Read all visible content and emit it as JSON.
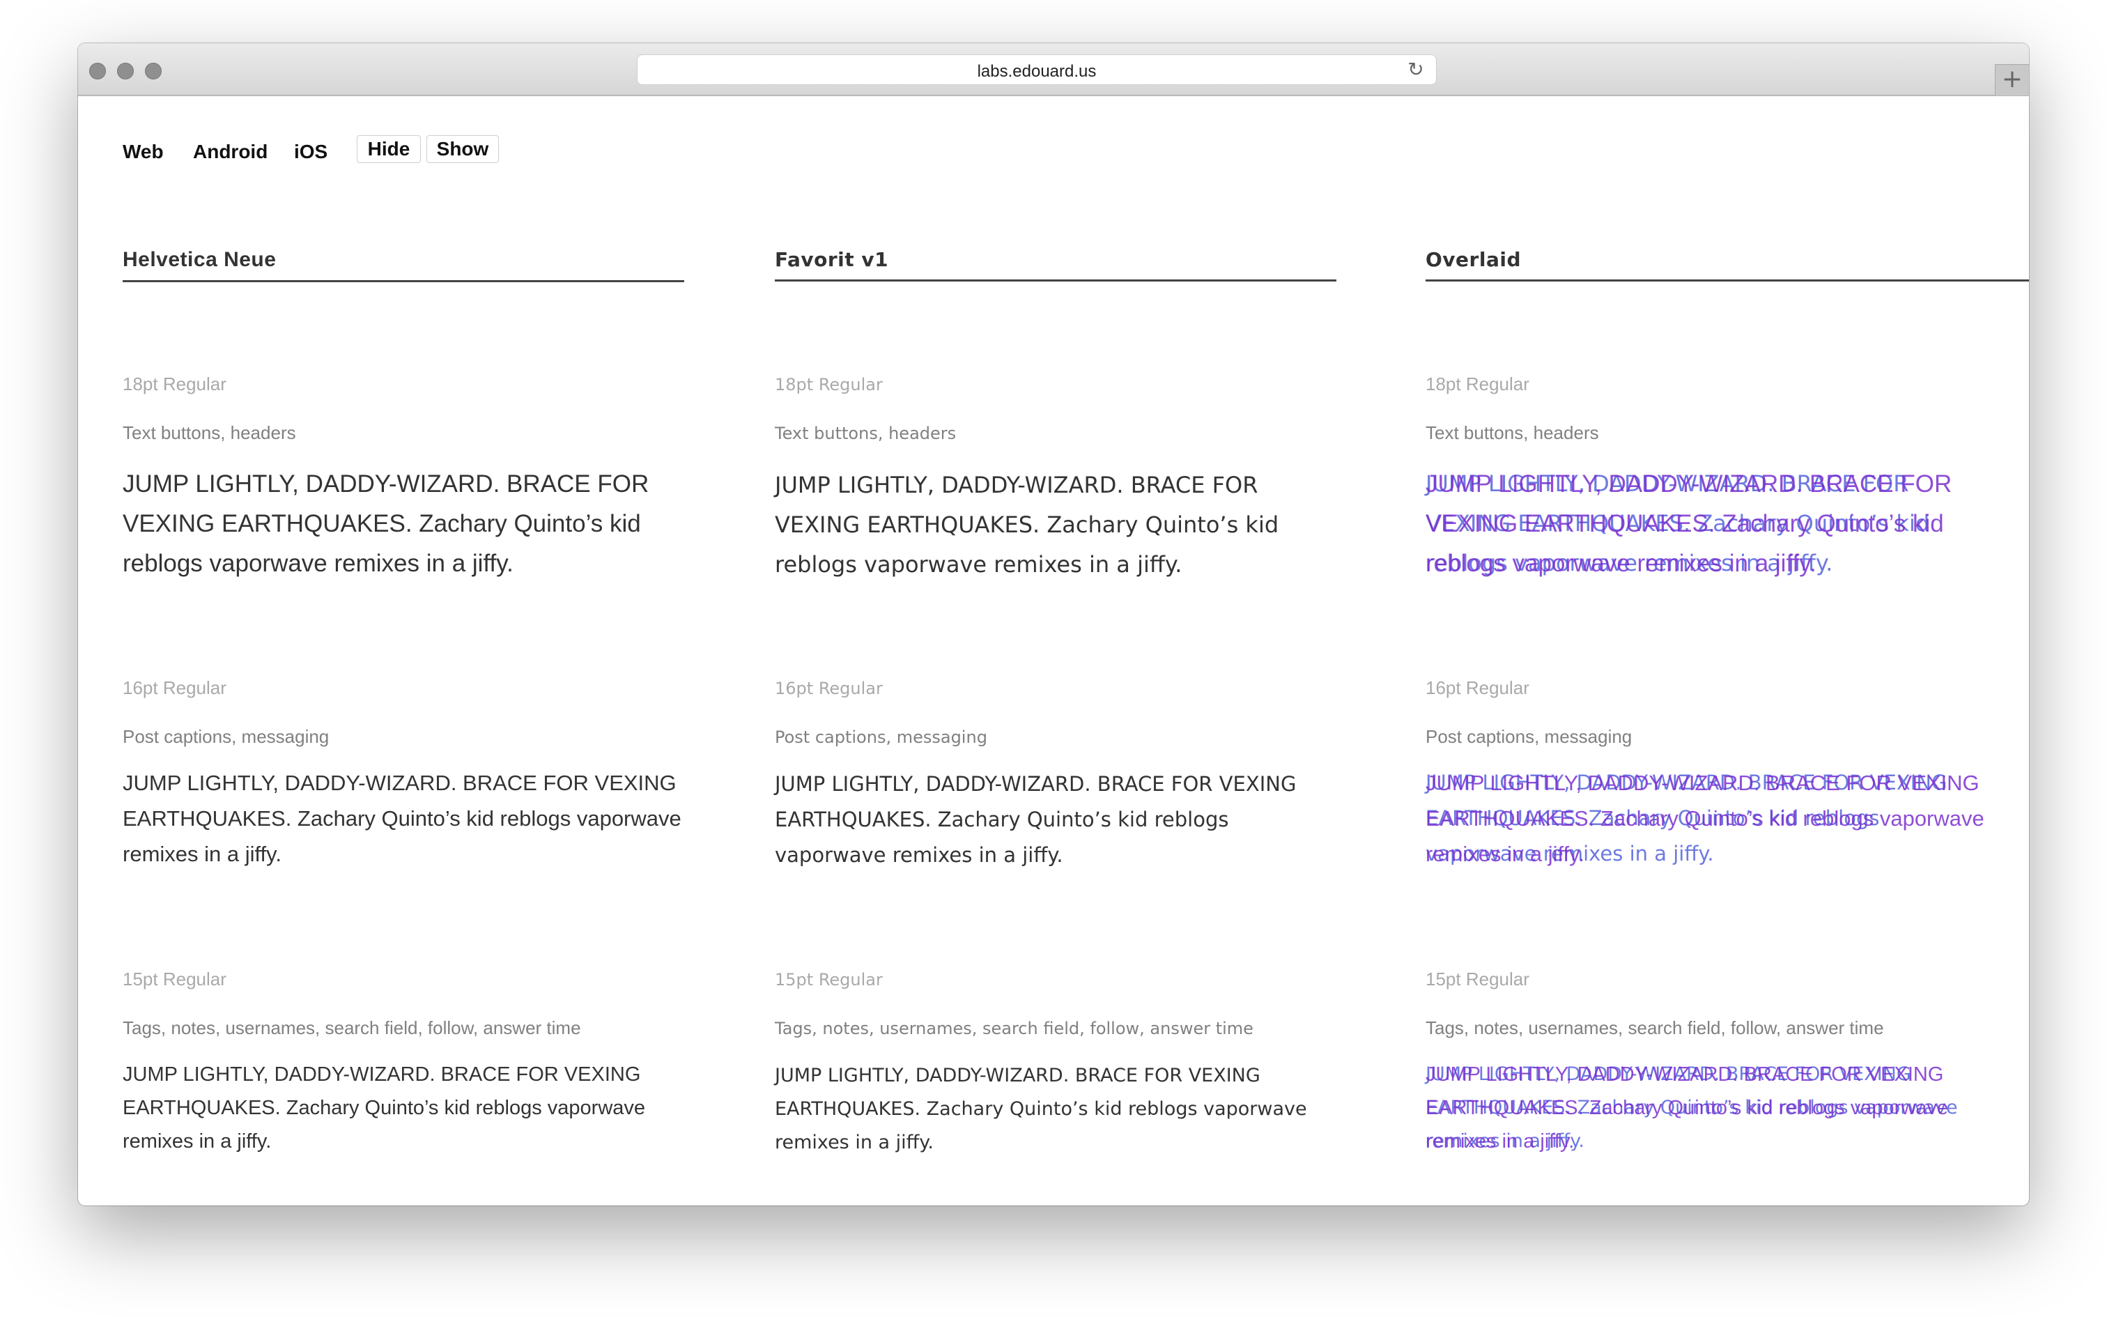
{
  "browser": {
    "url": "labs.edouard.us"
  },
  "nav": {
    "links": [
      "Web",
      "Android",
      "iOS"
    ],
    "hide_label": "Hide",
    "show_label": "Show"
  },
  "columns": [
    {
      "heading": "Helvetica Neue",
      "sections": [
        {
          "size": "18pt Regular",
          "usage": "Text buttons, headers",
          "sample": "JUMP LIGHTLY, DADDY-WIZARD. BRACE FOR VEXING EARTHQUAKES. Zachary Quinto’s kid reblogs vaporwave remixes in a jiffy."
        },
        {
          "size": "16pt Regular",
          "usage": "Post captions, messaging",
          "sample": "JUMP LIGHTLY, DADDY-WIZARD. BRACE FOR VEXING EARTHQUAKES. Zachary Quinto’s kid reblogs vaporwave remixes in a jiffy."
        },
        {
          "size": "15pt Regular",
          "usage": "Tags, notes, usernames, search field, follow, answer time",
          "sample": "JUMP LIGHTLY, DADDY-WIZARD. BRACE FOR VEXING EARTHQUAKES. Zachary Quinto’s kid reblogs vaporwave remixes in a jiffy."
        }
      ]
    },
    {
      "heading": "Favorit v1",
      "sections": [
        {
          "size": "18pt Regular",
          "usage": "Text buttons, headers",
          "sample": "JUMP LIGHTLY, DADDY-WIZARD. BRACE FOR VEXING EARTHQUAKES. Zachary Quinto’s kid reblogs vaporwave remixes in a jiffy."
        },
        {
          "size": "16pt Regular",
          "usage": "Post captions, messaging",
          "sample": "JUMP LIGHTLY, DADDY-WIZARD. BRACE FOR VEXING EARTHQUAKES. Zachary Quinto’s kid reblogs vaporwave remixes in a jiffy."
        },
        {
          "size": "15pt Regular",
          "usage": "Tags, notes, usernames, search field, follow, answer time",
          "sample": "JUMP LIGHTLY, DADDY-WIZARD. BRACE FOR VEXING EARTHQUAKES. Zachary Quinto’s kid reblogs vaporwave remixes in a jiffy."
        }
      ]
    },
    {
      "heading": "Overlaid",
      "sections": [
        {
          "size": "18pt Regular",
          "usage": "Text buttons, headers",
          "sample": "JUMP LIGHTLY, DADDY-WIZARD. BRACE FOR VEXING EARTHQUAKES. Zachary Quinto’s kid reblogs vaporwave remixes in a jiffy."
        },
        {
          "size": "16pt Regular",
          "usage": "Post captions, messaging",
          "sample": "JUMP LIGHTLY, DADDY-WIZARD. BRACE FOR VEXING EARTHQUAKES. Zachary Quinto’s kid reblogs vaporwave remixes in a jiffy."
        },
        {
          "size": "15pt Regular",
          "usage": "Tags, notes, usernames, search field, follow, answer time",
          "sample": "JUMP LIGHTLY, DADDY-WIZARD. BRACE FOR VEXING EARTHQUAKES. Zachary Quinto’s kid reblogs vaporwave remixes in a jiffy."
        }
      ]
    }
  ],
  "colors": {
    "overlay_purple": "#7b2fd0",
    "overlay_blue": "#3d4ed8",
    "overlay_dark": "#3d1c7a",
    "heading_rule": "#444444"
  },
  "icons": {
    "reload": "reload-icon",
    "new_tab": "plus-icon",
    "window_controls": "traffic-light-icon"
  }
}
